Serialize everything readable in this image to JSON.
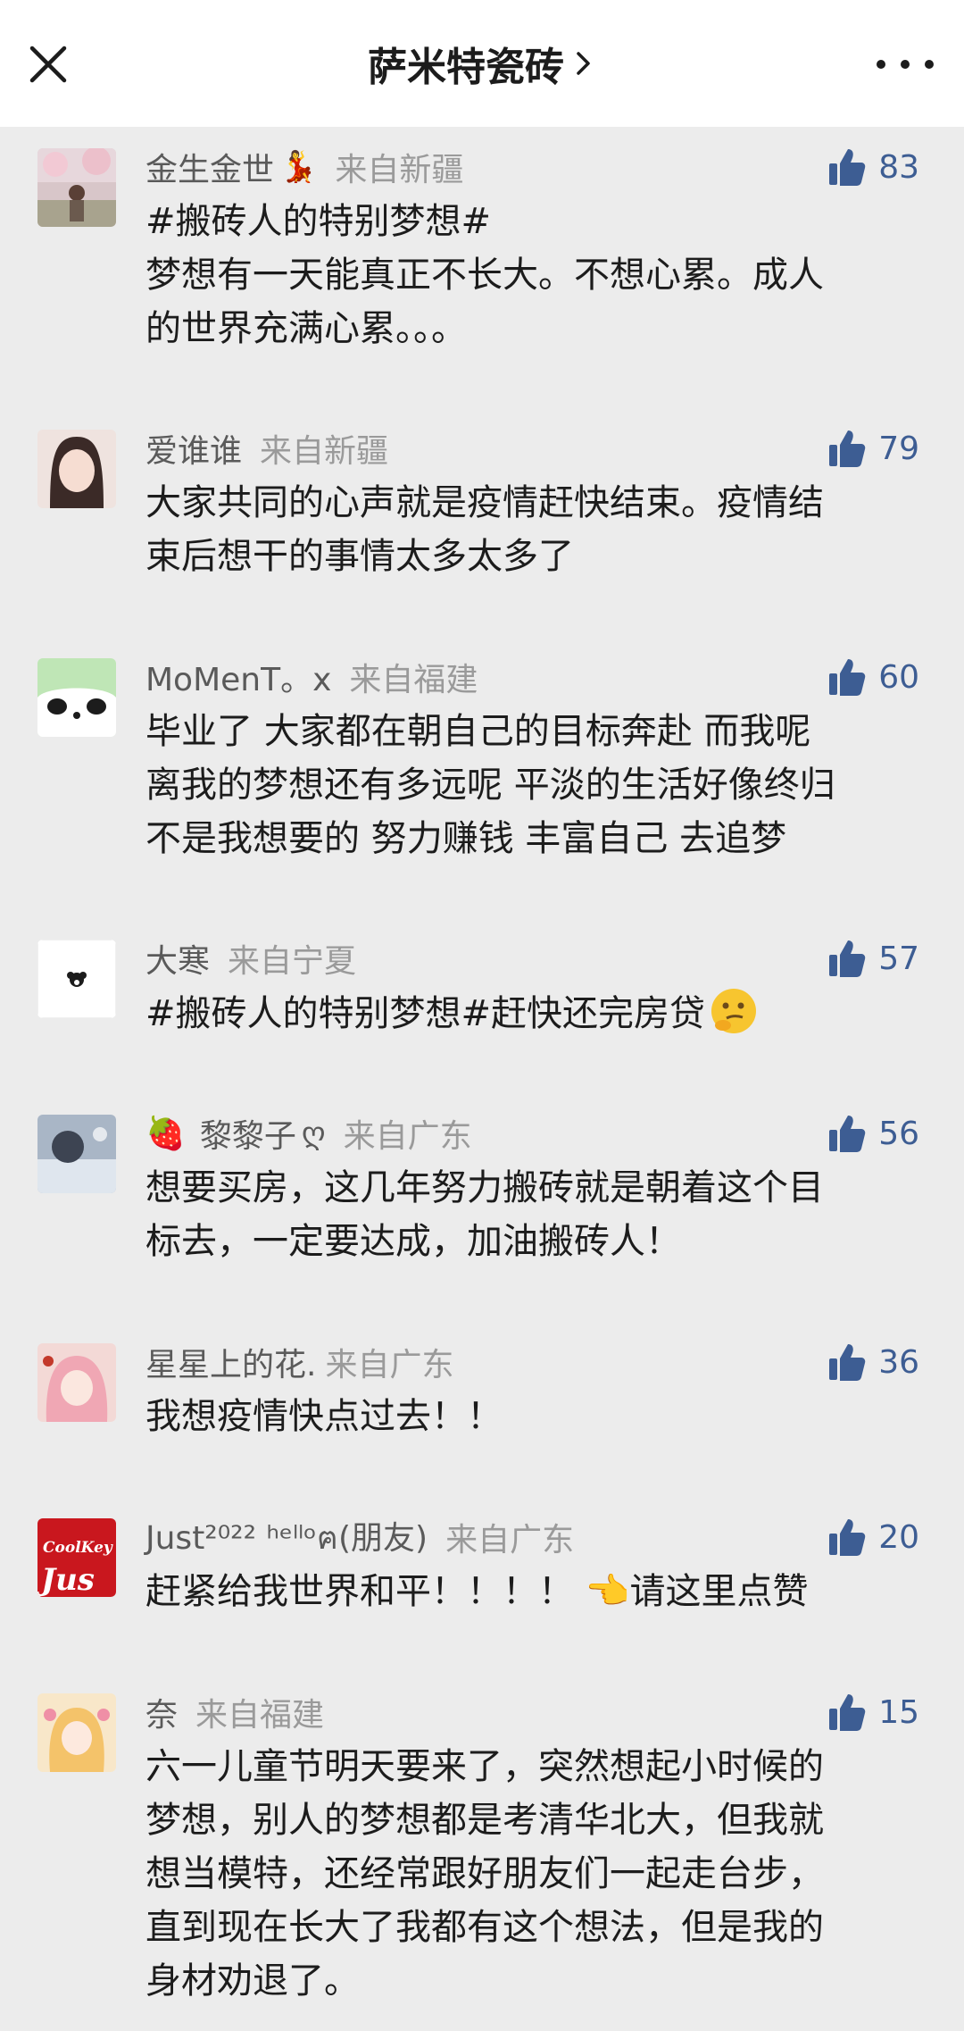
{
  "header": {
    "title": "萨米特瓷砖",
    "chevron": "›"
  },
  "comments": [
    {
      "nick": "金生金世",
      "badge": "💃",
      "location": "来自新疆",
      "likes": "83",
      "lines": [
        "#搬砖人的特别梦想#",
        "梦想有一天能真正不长大。不想心累。成人",
        "的世界充满心累。。。"
      ]
    },
    {
      "nick": "爱谁谁",
      "location": "来自新疆",
      "likes": "79",
      "lines": [
        "大家共同的心声就是疫情赶快结束。疫情结",
        "束后想干的事情太多太多了"
      ]
    },
    {
      "nick": "MoMenT。x",
      "location": "来自福建",
      "likes": "60",
      "lines": [
        "毕业了 大家都在朝自己的目标奔赴 而我呢",
        "离我的梦想还有多远呢 平淡的生活好像终归",
        "不是我想要的 努力赚钱 丰富自己 去追梦"
      ]
    },
    {
      "nick": "大寒",
      "location": "来自宁夏",
      "likes": "57",
      "lines": [
        "#搬砖人的特别梦想#赶快还完房贷"
      ],
      "emoji": "thinking-emoji"
    },
    {
      "nick": "黎黎子",
      "prefix": "🍓",
      "badge": "ღ",
      "location": "来自广东",
      "likes": "56",
      "lines": [
        "想要买房，这几年努力搬砖就是朝着这个目",
        "标去，一定要达成，加油搬砖人！"
      ]
    },
    {
      "nick": "星星上的花.",
      "location": "来自广东",
      "likes": "36",
      "lines": [
        "我想疫情快点过去！！"
      ]
    },
    {
      "nick": "Just²⁰²² ʰᵉˡˡᵒฅ(朋友)",
      "location": "来自广东",
      "likes": "20",
      "lines": [
        "赶紧给我世界和平！！！！ 👈请这里点赞"
      ]
    },
    {
      "nick": "奈",
      "location": "来自福建",
      "likes": "15",
      "lines": [
        "六一儿童节明天要来了，突然想起小时候的",
        "梦想，别人的梦想都是考清华北大，但我就",
        "想当模特，还经常跟好朋友们一起走台步，",
        "直到现在长大了我都有这个想法，但是我的",
        "身材劝退了。"
      ]
    }
  ],
  "colors": {
    "background": "#ececec",
    "nickname": "#5a5a5a",
    "location": "#9a9a9a",
    "like_accent": "#3d5d93",
    "text": "#1c1c1c"
  }
}
